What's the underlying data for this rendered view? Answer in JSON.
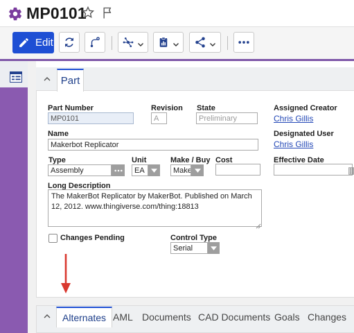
{
  "header": {
    "title": "MP0101",
    "icon": "gear-icon",
    "favorite_icon": "star-icon",
    "flag_icon": "flag-icon"
  },
  "toolbar": {
    "edit_label": "Edit",
    "buttons": [
      "refresh-icon",
      "workflow-icon",
      "network-icon",
      "clipboard-icon",
      "share-icon",
      "more-icon"
    ]
  },
  "part_panel": {
    "tab_label": "Part",
    "fields": {
      "part_number": {
        "label": "Part Number",
        "value": "MP0101"
      },
      "revision": {
        "label": "Revision",
        "value": "A"
      },
      "state": {
        "label": "State",
        "value": "Preliminary"
      },
      "assigned_creator": {
        "label": "Assigned Creator",
        "value": "Chris Gillis"
      },
      "name": {
        "label": "Name",
        "value": "Makerbot Replicator"
      },
      "designated_user": {
        "label": "Designated User",
        "value": "Chris Gillis"
      },
      "type": {
        "label": "Type",
        "value": "Assembly"
      },
      "unit": {
        "label": "Unit",
        "value": "EA"
      },
      "make_buy": {
        "label": "Make / Buy",
        "value": "Make"
      },
      "cost": {
        "label": "Cost",
        "value": ""
      },
      "effective_date": {
        "label": "Effective Date",
        "value": ""
      },
      "long_description": {
        "label": "Long Description",
        "value": "The MakerBot Replicator by MakerBot. Published on March 12, 2012. www.thingiverse.com/thing:18813"
      },
      "changes_pending": {
        "label": "Changes Pending",
        "checked": false
      },
      "control_type": {
        "label": "Control Type",
        "value": "Serial"
      }
    }
  },
  "bottom_tabs": {
    "active": "Alternates",
    "items": [
      "Alternates",
      "AML",
      "Documents",
      "CAD Documents",
      "Goals",
      "Changes"
    ]
  },
  "colors": {
    "accent": "#1e4fd4",
    "brand_purple": "#8a5ab0",
    "annotation_arrow": "#d9382f"
  }
}
